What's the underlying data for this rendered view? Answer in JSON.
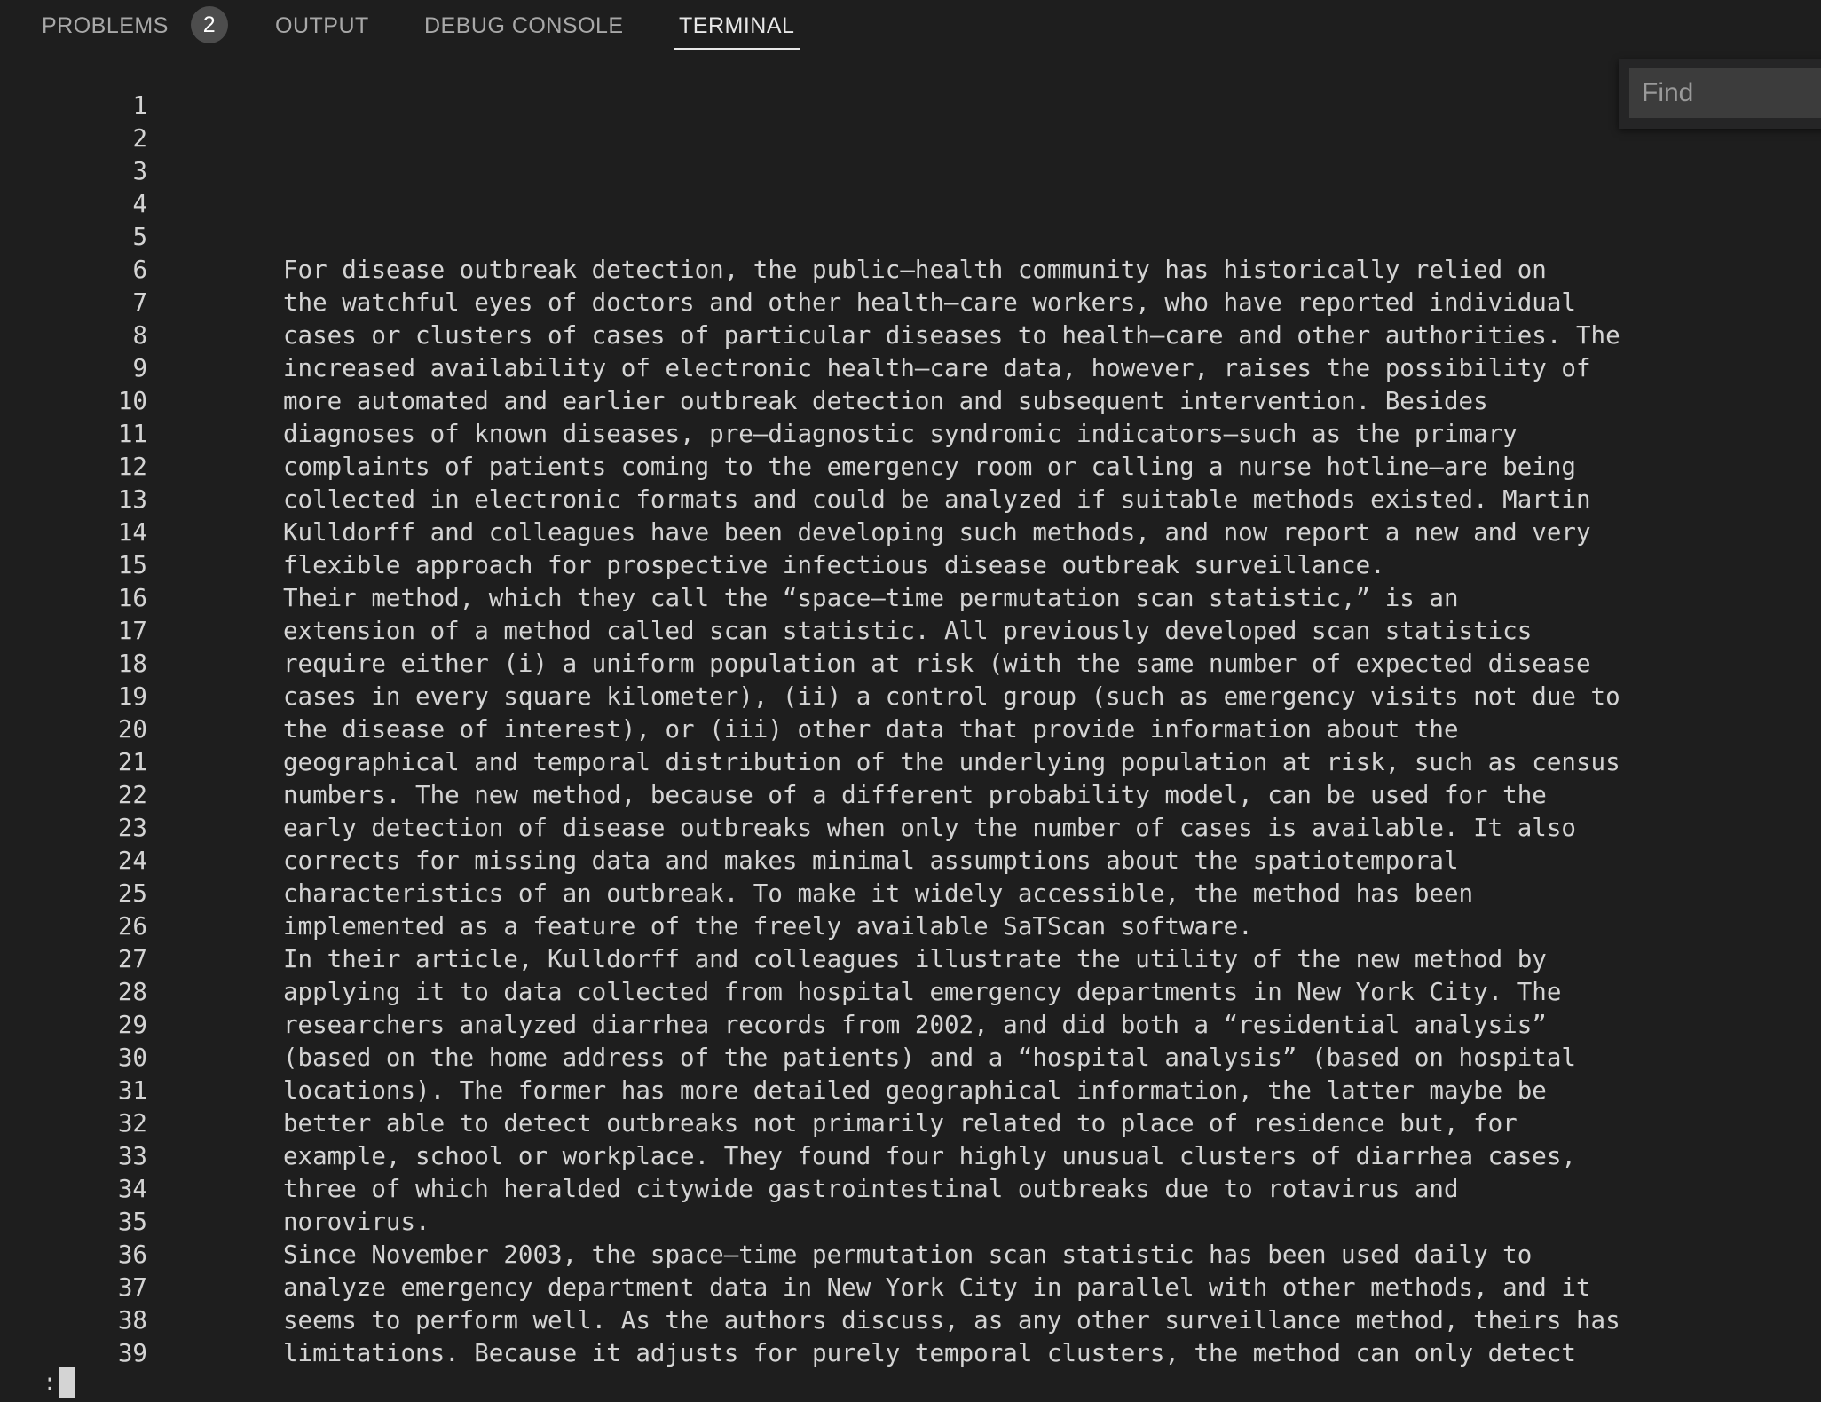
{
  "tabs": {
    "problems": "PROBLEMS",
    "problems_count": "2",
    "output": "OUTPUT",
    "debug_console": "DEBUG CONSOLE",
    "terminal": "TERMINAL"
  },
  "find": {
    "placeholder": "Find"
  },
  "prompt": {
    "symbol": ":"
  },
  "lines": [
    "",
    "",
    "",
    "",
    "",
    "For disease outbreak detection, the public–health community has historically relied on",
    "the watchful eyes of doctors and other health–care workers, who have reported individual",
    "cases or clusters of cases of particular diseases to health–care and other authorities. The",
    "increased availability of electronic health–care data, however, raises the possibility of",
    "more automated and earlier outbreak detection and subsequent intervention. Besides",
    "diagnoses of known diseases, pre–diagnostic syndromic indicators—such as the primary",
    "complaints of patients coming to the emergency room or calling a nurse hotline—are being",
    "collected in electronic formats and could be analyzed if suitable methods existed. Martin",
    "Kulldorff and colleagues have been developing such methods, and now report a new and very",
    "flexible approach for prospective infectious disease outbreak surveillance.",
    "Their method, which they call the “space–time permutation scan statistic,” is an",
    "extension of a method called scan statistic. All previously developed scan statistics",
    "require either (i) a uniform population at risk (with the same number of expected disease",
    "cases in every square kilometer), (ii) a control group (such as emergency visits not due to",
    "the disease of interest), or (iii) other data that provide information about the",
    "geographical and temporal distribution of the underlying population at risk, such as census",
    "numbers. The new method, because of a different probability model, can be used for the",
    "early detection of disease outbreaks when only the number of cases is available. It also",
    "corrects for missing data and makes minimal assumptions about the spatiotemporal",
    "characteristics of an outbreak. To make it widely accessible, the method has been",
    "implemented as a feature of the freely available SaTScan software.",
    "In their article, Kulldorff and colleagues illustrate the utility of the new method by",
    "applying it to data collected from hospital emergency departments in New York City. The",
    "researchers analyzed diarrhea records from 2002, and did both a “residential analysis”",
    "(based on the home address of the patients) and a “hospital analysis” (based on hospital",
    "locations). The former has more detailed geographical information, the latter maybe be",
    "better able to detect outbreaks not primarily related to place of residence but, for",
    "example, school or workplace. They found four highly unusual clusters of diarrhea cases,",
    "three of which heralded citywide gastrointestinal outbreaks due to rotavirus and",
    "norovirus.",
    "Since November 2003, the space–time permutation scan statistic has been used daily to",
    "analyze emergency department data in New York City in parallel with other methods, and it",
    "seems to perform well. As the authors discuss, as any other surveillance method, theirs has",
    "limitations. Because it adjusts for purely temporal clusters, the method can only detect"
  ]
}
